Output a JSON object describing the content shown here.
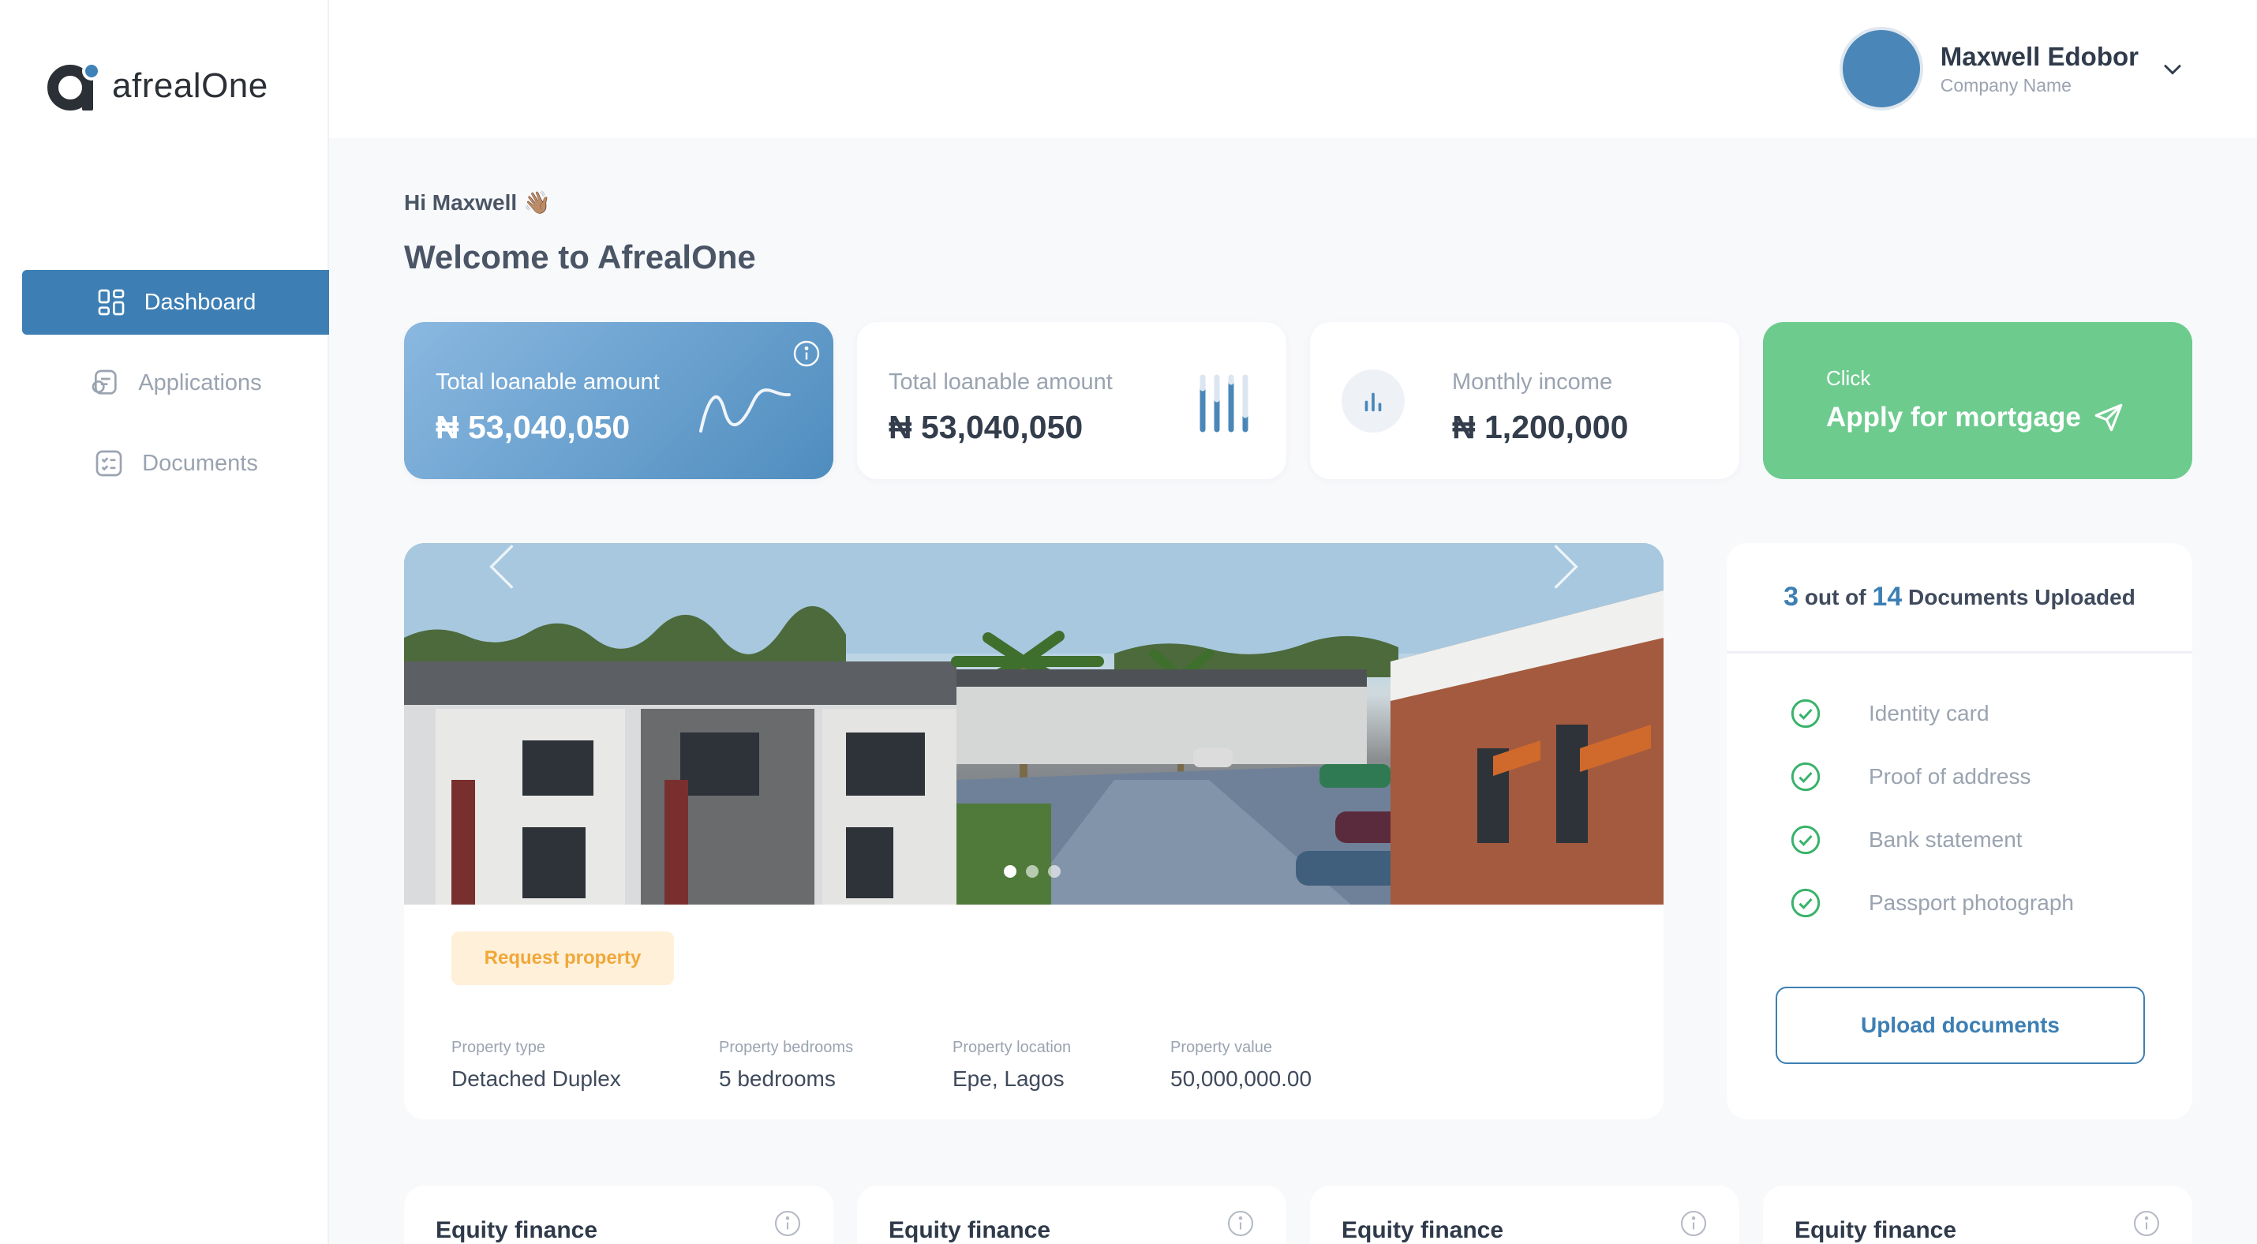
{
  "brand": {
    "name": "afrealOne",
    "accent": "#3d7fb4",
    "green": "#6dcb8e"
  },
  "sidebar": {
    "items": [
      {
        "label": "Dashboard",
        "icon": "dashboard-icon",
        "active": true
      },
      {
        "label": "Applications",
        "icon": "applications-icon",
        "active": false
      },
      {
        "label": "Documents",
        "icon": "documents-icon",
        "active": false
      }
    ]
  },
  "header": {
    "user_name": "Maxwell Edobor",
    "company": "Company Name"
  },
  "main": {
    "greeting": "Hi Maxwell 👋🏽",
    "welcome": "Welcome to AfrealOne",
    "stats": [
      {
        "label": "Total loanable amount",
        "value": "₦ 53,040,050"
      },
      {
        "label": "Total loanable amount",
        "value": "₦ 53,040,050"
      },
      {
        "label": "Monthly income",
        "value": "₦ 1,200,000"
      }
    ],
    "apply": {
      "small": "Click",
      "label": "Apply for mortgage"
    }
  },
  "property": {
    "request_label": "Request property",
    "carousel_active": 1,
    "details": [
      {
        "key": "Property type",
        "value": "Detached Duplex"
      },
      {
        "key": "Property bedrooms",
        "value": "5 bedrooms"
      },
      {
        "key": "Property location",
        "value": "Epe, Lagos"
      },
      {
        "key": "Property value",
        "value": "50,000,000.00"
      }
    ]
  },
  "documents": {
    "uploaded": "3",
    "total": "14",
    "out_of": "out of",
    "suffix": "Documents Uploaded",
    "items": [
      "Identity card",
      "Proof of address",
      "Bank statement",
      "Passport photograph"
    ],
    "upload_label": "Upload documents"
  },
  "finance_cards": [
    "Equity finance",
    "Equity finance",
    "Equity finance",
    "Equity finance"
  ]
}
